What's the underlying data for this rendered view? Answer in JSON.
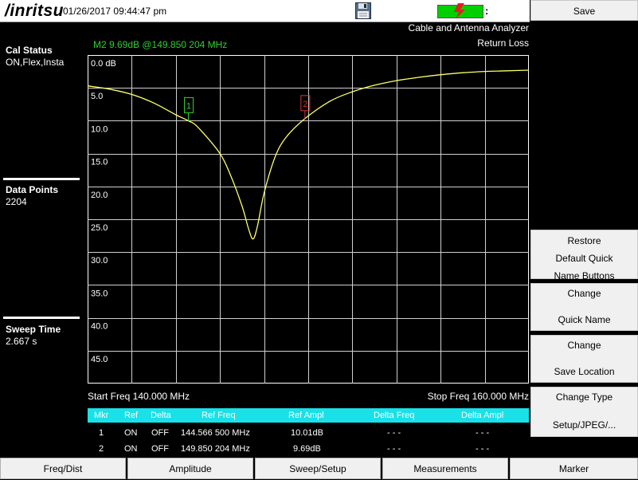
{
  "header": {
    "logo_text": "/inritsu",
    "datetime": "01/26/2017 09:44:47 pm",
    "battery_suffix": ":",
    "battery_color": "#00d000",
    "icons": [
      "floppy-disk-icon",
      "lightning-bolt-icon"
    ]
  },
  "app_title": "Cable and Antenna Analyzer",
  "mode_title": "Return Loss",
  "marker_readout": "M2 9.69dB @149.850 204 MHz",
  "left_panel": {
    "cal_status_label": "Cal Status",
    "cal_status_value": "ON,Flex,Insta",
    "data_points_label": "Data Points",
    "data_points_value": "2204",
    "sweep_time_label": "Sweep Time",
    "sweep_time_value": "2.667 s"
  },
  "chart_data": {
    "type": "line",
    "y_tick_labels": [
      "0.0 dB",
      "5.0",
      "10.0",
      "15.0",
      "20.0",
      "25.0",
      "30.0",
      "35.0",
      "40.0",
      "45.0"
    ],
    "ylim": [
      0,
      50
    ],
    "y_inverted": true,
    "xlim_mhz": [
      140.0,
      160.0
    ],
    "grid": true,
    "trace_color": "#ffff66",
    "series": [
      {
        "x_mhz": [
          140.0,
          141.0,
          142.0,
          143.0,
          144.0,
          144.566,
          145.0,
          146.0,
          146.5,
          147.0,
          147.3,
          147.5,
          147.7,
          148.0,
          148.5,
          149.0,
          149.85,
          151.0,
          152.0,
          153.0,
          154.0,
          155.0,
          156.0,
          157.0,
          158.0,
          159.0,
          160.0
        ],
        "return_loss_db": [
          4.7,
          5.2,
          6.0,
          7.3,
          9.1,
          10.01,
          11.0,
          15.0,
          18.5,
          23.0,
          26.5,
          28.0,
          26.0,
          21.0,
          15.5,
          12.5,
          9.69,
          7.0,
          5.6,
          4.6,
          3.9,
          3.4,
          3.0,
          2.7,
          2.5,
          2.4,
          2.3
        ]
      }
    ],
    "markers": [
      {
        "label": "1",
        "x_mhz": 144.5665,
        "y_db": 10.01,
        "color": "#33cc33"
      },
      {
        "label": "2",
        "x_mhz": 149.850204,
        "y_db": 9.69,
        "color": "#dd3333"
      }
    ]
  },
  "start_freq": "Start Freq 140.000 MHz",
  "stop_freq": "Stop Freq 160.000 MHz",
  "marker_table": {
    "headers": [
      "Mkr",
      "Ref",
      "Delta",
      "Ref Freq",
      "Ref Ampl",
      "Delta Freq",
      "Delta Ampl"
    ],
    "rows": [
      [
        "1",
        "ON",
        "OFF",
        "144.566 500 MHz",
        "10.01dB",
        "- - -",
        "- - -"
      ],
      [
        "2",
        "ON",
        "OFF",
        "149.850 204 MHz",
        "9.69dB",
        "- - -",
        "- - -"
      ]
    ]
  },
  "softkeys": {
    "save": "Save",
    "restore_l1": "Restore",
    "restore_l2": "Default Quick",
    "restore_l3": "Name Buttons",
    "change_qn_l1": "Change",
    "change_qn_l2": "Quick Name",
    "change_sl_l1": "Change",
    "change_sl_l2": "Save Location",
    "change_type_l1": "Change Type",
    "change_type_l2": "Setup/JPEG/..."
  },
  "bottom_menu": [
    "Freq/Dist",
    "Amplitude",
    "Sweep/Setup",
    "Measurements",
    "Marker"
  ]
}
